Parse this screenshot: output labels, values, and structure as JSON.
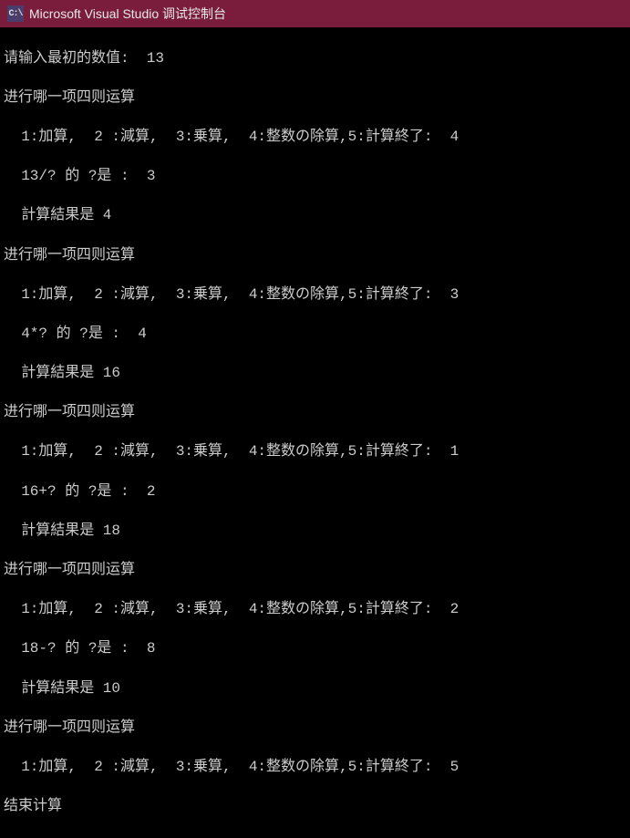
{
  "window": {
    "icon_text": "C:\\",
    "title": "Microsoft Visual Studio 调试控制台"
  },
  "terminal": {
    "lines": [
      "请输入最初的数值:  13",
      "进行哪一项四则运算",
      "  1:加算,  2 :減算,  3:乗算,  4:整数の除算,5:計算終了:  4",
      "  13/? 的 ?是 :  3",
      "  計算結果是 4",
      "进行哪一项四则运算",
      "  1:加算,  2 :減算,  3:乗算,  4:整数の除算,5:計算終了:  3",
      "  4*? 的 ?是 :  4",
      "  計算結果是 16",
      "进行哪一项四则运算",
      "  1:加算,  2 :減算,  3:乗算,  4:整数の除算,5:計算終了:  1",
      "  16+? 的 ?是 :  2",
      "  計算結果是 18",
      "进行哪一项四则运算",
      "  1:加算,  2 :減算,  3:乗算,  4:整数の除算,5:計算終了:  2",
      "  18-? 的 ?是 :  8",
      "  計算結果是 10",
      "进行哪一项四则运算",
      "  1:加算,  2 :減算,  3:乗算,  4:整数の除算,5:計算終了:  5",
      "结束计算"
    ]
  }
}
